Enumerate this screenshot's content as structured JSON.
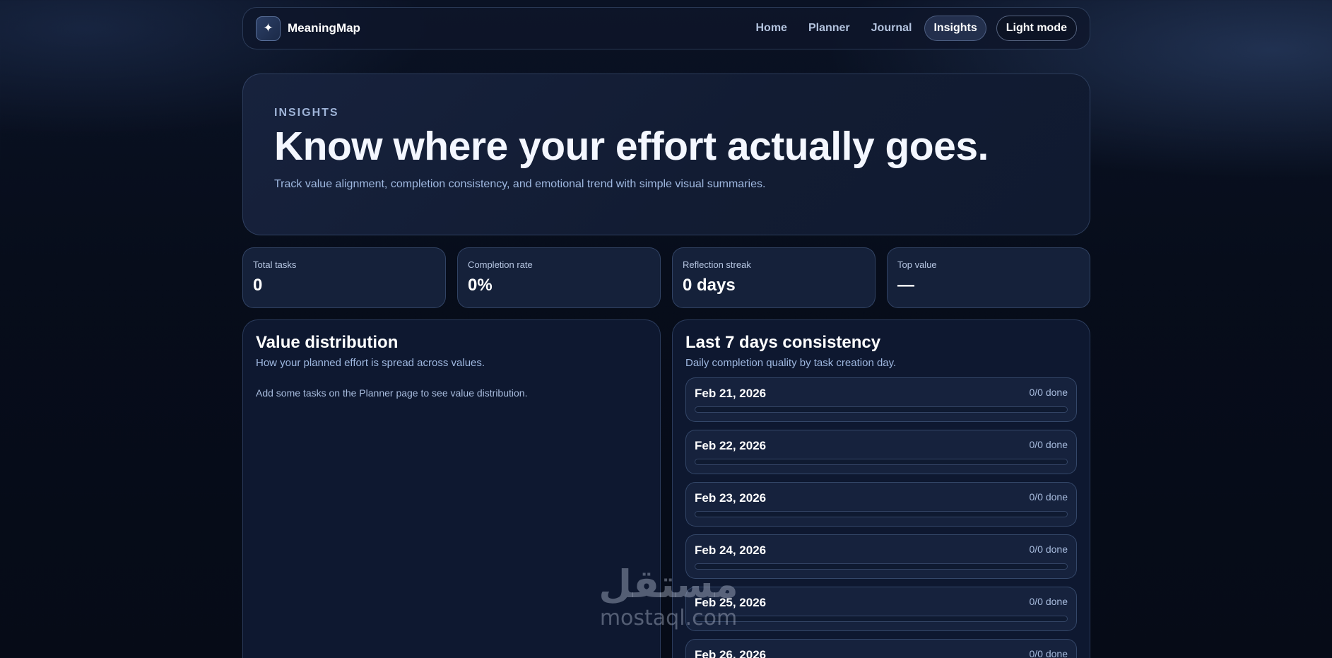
{
  "nav": {
    "logo_glyph": "✦",
    "brand": "MeaningMap",
    "links": [
      {
        "label": "Home",
        "active": false
      },
      {
        "label": "Planner",
        "active": false
      },
      {
        "label": "Journal",
        "active": false
      },
      {
        "label": "Insights",
        "active": true
      }
    ],
    "theme_toggle": "Light mode"
  },
  "hero": {
    "eyebrow": "INSIGHTS",
    "title": "Know where your effort actually goes.",
    "subtitle": "Track value alignment, completion consistency, and emotional trend with simple visual summaries."
  },
  "stats": [
    {
      "label": "Total tasks",
      "value": "0"
    },
    {
      "label": "Completion rate",
      "value": "0%"
    },
    {
      "label": "Reflection streak",
      "value": "0 days"
    },
    {
      "label": "Top value",
      "value": "—"
    }
  ],
  "value_distribution": {
    "title": "Value distribution",
    "subtitle": "How your planned effort is spread across values.",
    "empty_message": "Add some tasks on the Planner page to see value distribution."
  },
  "consistency": {
    "title": "Last 7 days consistency",
    "subtitle": "Daily completion quality by task creation day.",
    "days": [
      {
        "date": "Feb 21, 2026",
        "count": "0/0 done",
        "progress": 0
      },
      {
        "date": "Feb 22, 2026",
        "count": "0/0 done",
        "progress": 0
      },
      {
        "date": "Feb 23, 2026",
        "count": "0/0 done",
        "progress": 0
      },
      {
        "date": "Feb 24, 2026",
        "count": "0/0 done",
        "progress": 0
      },
      {
        "date": "Feb 25, 2026",
        "count": "0/0 done",
        "progress": 0
      },
      {
        "date": "Feb 26, 2026",
        "count": "0/0 done",
        "progress": 0
      }
    ]
  },
  "watermark": {
    "arabic": "مستقل",
    "latin": "mostaql.com"
  }
}
